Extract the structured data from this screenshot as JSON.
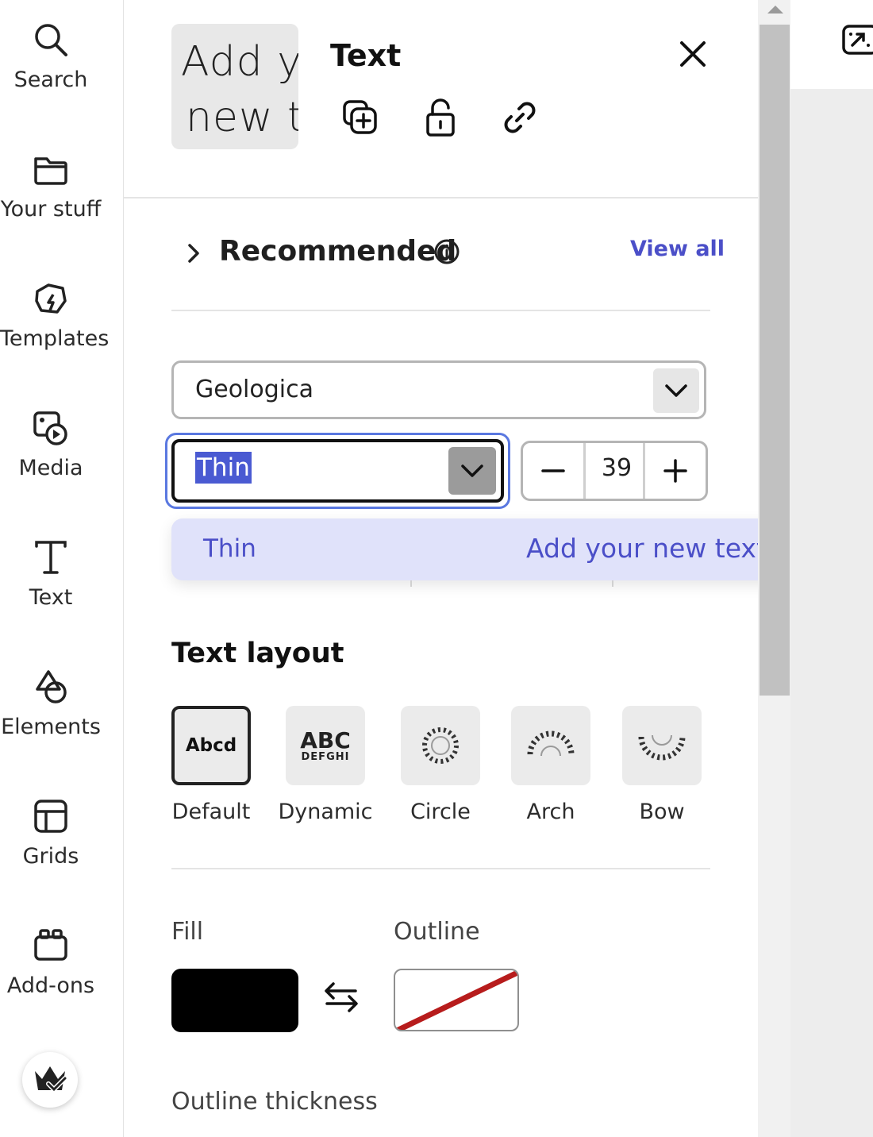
{
  "rail": {
    "items": [
      {
        "label": "Search",
        "icon": "search-icon"
      },
      {
        "label": "Your stuff",
        "icon": "folder-icon"
      },
      {
        "label": "Templates",
        "icon": "templates-icon"
      },
      {
        "label": "Media",
        "icon": "media-icon"
      },
      {
        "label": "Text",
        "icon": "text-icon"
      },
      {
        "label": "Elements",
        "icon": "shapes-icon"
      },
      {
        "label": "Grids",
        "icon": "grid-icon"
      },
      {
        "label": "Add-ons",
        "icon": "addons-icon"
      }
    ],
    "premium_icon": "crown-check-icon"
  },
  "panel": {
    "thumbnail_line1": "Add y",
    "thumbnail_line2": "new t",
    "title": "Text",
    "actions": [
      "duplicate-icon",
      "unlock-icon",
      "link-icon"
    ],
    "close_icon": "close-icon"
  },
  "recommended": {
    "title": "Recommended",
    "view_all": "View all"
  },
  "font": {
    "family": "Geologica",
    "weight": "Thin",
    "size": "39",
    "weight_menu": {
      "option": "Thin",
      "preview": "Add your new text"
    }
  },
  "text_layout": {
    "title": "Text layout",
    "options": [
      {
        "label": "Default",
        "tile": "Abcd",
        "selected": true
      },
      {
        "label": "Dynamic",
        "tile_line1": "ABC",
        "tile_line2": "DEFGHI",
        "selected": false
      },
      {
        "label": "Circle",
        "selected": false
      },
      {
        "label": "Arch",
        "selected": false
      },
      {
        "label": "Bow",
        "selected": false
      }
    ]
  },
  "colors": {
    "fill_label": "Fill",
    "outline_label": "Outline",
    "fill_color": "#000000",
    "outline_none_stroke": "#b71c1c",
    "accent": "#4b4fc8"
  },
  "outline_thickness_label": "Outline thickness"
}
